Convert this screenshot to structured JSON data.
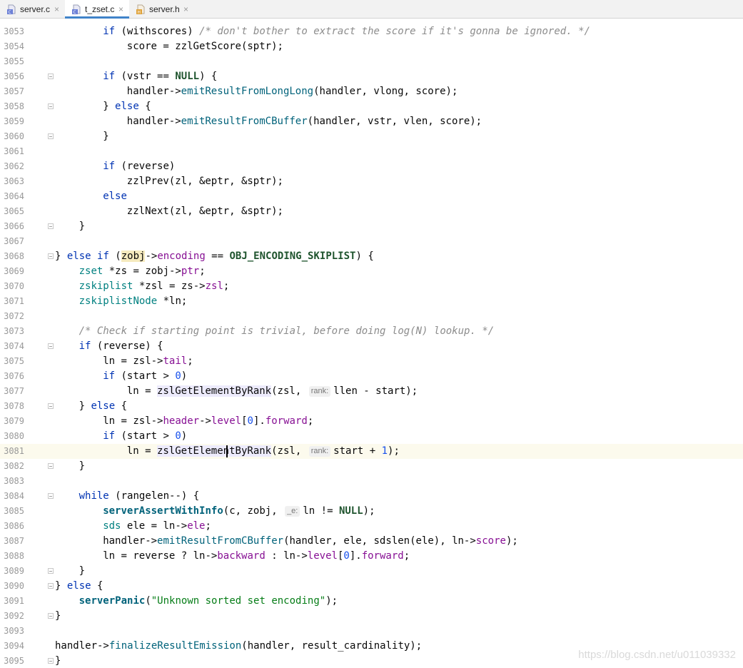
{
  "tabs": [
    {
      "label": "server.c",
      "icon": "c-file-icon",
      "active": false
    },
    {
      "label": "t_zset.c",
      "icon": "c-file-icon",
      "active": true
    },
    {
      "label": "server.h",
      "icon": "h-file-icon",
      "active": false
    }
  ],
  "close_glyph": "×",
  "hints": {
    "rank": "rank:",
    "e": "_e:"
  },
  "colors": {
    "keyword": "#0033b3",
    "function": "#00627a",
    "field": "#871094",
    "number": "#1750eb",
    "string": "#067d17",
    "comment": "#8c8c8c",
    "current_line": "#fcfaed",
    "active_tab_underline": "#4083c9"
  },
  "current_line": "3081",
  "lines": [
    {
      "n": "3053",
      "fold": false,
      "code": "        if (withscores) /* don't bother to extract the score if it's gonna be ignored. */"
    },
    {
      "n": "3054",
      "fold": false,
      "code": "            score = zzlGetScore(sptr);"
    },
    {
      "n": "3055",
      "fold": false,
      "code": ""
    },
    {
      "n": "3056",
      "fold": true,
      "code": "        if (vstr == NULL) {"
    },
    {
      "n": "3057",
      "fold": false,
      "code": "            handler->emitResultFromLongLong(handler, vlong, score);"
    },
    {
      "n": "3058",
      "fold": true,
      "code": "        } else {"
    },
    {
      "n": "3059",
      "fold": false,
      "code": "            handler->emitResultFromCBuffer(handler, vstr, vlen, score);"
    },
    {
      "n": "3060",
      "fold": true,
      "code": "        }"
    },
    {
      "n": "3061",
      "fold": false,
      "code": ""
    },
    {
      "n": "3062",
      "fold": false,
      "code": "        if (reverse)"
    },
    {
      "n": "3063",
      "fold": false,
      "code": "            zzlPrev(zl, &eptr, &sptr);"
    },
    {
      "n": "3064",
      "fold": false,
      "code": "        else"
    },
    {
      "n": "3065",
      "fold": false,
      "code": "            zzlNext(zl, &eptr, &sptr);"
    },
    {
      "n": "3066",
      "fold": true,
      "code": "    }"
    },
    {
      "n": "3067",
      "fold": false,
      "code": ""
    },
    {
      "n": "3068",
      "fold": true,
      "code": "} else if (zobj->encoding == OBJ_ENCODING_SKIPLIST) {"
    },
    {
      "n": "3069",
      "fold": false,
      "code": "    zset *zs = zobj->ptr;"
    },
    {
      "n": "3070",
      "fold": false,
      "code": "    zskiplist *zsl = zs->zsl;"
    },
    {
      "n": "3071",
      "fold": false,
      "code": "    zskiplistNode *ln;"
    },
    {
      "n": "3072",
      "fold": false,
      "code": ""
    },
    {
      "n": "3073",
      "fold": false,
      "code": "    /* Check if starting point is trivial, before doing log(N) lookup. */"
    },
    {
      "n": "3074",
      "fold": true,
      "code": "    if (reverse) {"
    },
    {
      "n": "3075",
      "fold": false,
      "code": "        ln = zsl->tail;"
    },
    {
      "n": "3076",
      "fold": false,
      "code": "        if (start > 0)"
    },
    {
      "n": "3077",
      "fold": false,
      "code": "            ln = zslGetElementByRank(zsl, rank: llen - start);"
    },
    {
      "n": "3078",
      "fold": true,
      "code": "    } else {"
    },
    {
      "n": "3079",
      "fold": false,
      "code": "        ln = zsl->header->level[0].forward;"
    },
    {
      "n": "3080",
      "fold": false,
      "code": "        if (start > 0)"
    },
    {
      "n": "3081",
      "fold": false,
      "code": "            ln = zslGetElementByRank(zsl, rank: start + 1);"
    },
    {
      "n": "3082",
      "fold": true,
      "code": "    }"
    },
    {
      "n": "3083",
      "fold": false,
      "code": ""
    },
    {
      "n": "3084",
      "fold": true,
      "code": "    while (rangelen--) {"
    },
    {
      "n": "3085",
      "fold": false,
      "code": "        serverAssertWithInfo(c, zobj, _e: ln != NULL);"
    },
    {
      "n": "3086",
      "fold": false,
      "code": "        sds ele = ln->ele;"
    },
    {
      "n": "3087",
      "fold": false,
      "code": "        handler->emitResultFromCBuffer(handler, ele, sdslen(ele), ln->score);"
    },
    {
      "n": "3088",
      "fold": false,
      "code": "        ln = reverse ? ln->backward : ln->level[0].forward;"
    },
    {
      "n": "3089",
      "fold": true,
      "code": "    }"
    },
    {
      "n": "3090",
      "fold": true,
      "code": "} else {"
    },
    {
      "n": "3091",
      "fold": false,
      "code": "    serverPanic(\"Unknown sorted set encoding\");"
    },
    {
      "n": "3092",
      "fold": true,
      "code": "}"
    },
    {
      "n": "3093",
      "fold": false,
      "code": ""
    },
    {
      "n": "3094",
      "fold": false,
      "code": "handler->finalizeResultEmission(handler, result_cardinality);"
    },
    {
      "n": "3095",
      "fold": true,
      "code": "}"
    }
  ],
  "watermark": "https://blog.csdn.net/u011039332"
}
